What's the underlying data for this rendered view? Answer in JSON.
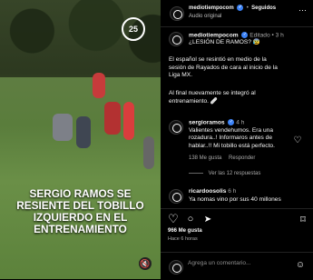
{
  "media": {
    "caption": "SERGIO RAMOS SE RESIENTE DEL TOBILLO IZQUIERDO EN EL ENTRENAMIENTO",
    "logo_text": "25"
  },
  "post_header": {
    "username": "mediotiempocom",
    "follow_label": "Seguidos",
    "audio_label": "Audio original"
  },
  "post": {
    "username": "mediotiempocom",
    "edited": "Editado",
    "age": "3 h",
    "caption_lines": [
      "¿LESIÓN DE RAMOS? 😰",
      "El español se resintió en medio de la",
      "sesión de Rayados de cara al inicio de la",
      "Liga MX.",
      "Al final nuevamente se integró al",
      "entrenamiento. 🩹"
    ],
    "comments": [
      {
        "username": "sergioramos",
        "age": "4 h",
        "text_lines": [
          "Valientes vendehumos. Era una",
          "rozadura..! Informaros antes de",
          "hablar..!! Mi tobillo está perfecto."
        ],
        "likes": "138 Me gusta",
        "reply": "Responder",
        "replies_toggle": "Ver las 12 respuestas"
      },
      {
        "username": "ricardoosolis",
        "age": "6 h",
        "text_lines": [
          "Ya nomas vino por sus 40 millones"
        ]
      }
    ]
  },
  "actions": {
    "likes_count": "966 Me gusta",
    "time_ago": "Hace 6 horas"
  },
  "comment_box": {
    "placeholder": "Agrega un comentario..."
  },
  "icons": {
    "heart": "♡",
    "comment": "○",
    "share": "➤",
    "bookmark": "⌑",
    "emoji": "☺",
    "mute": "🔇"
  }
}
